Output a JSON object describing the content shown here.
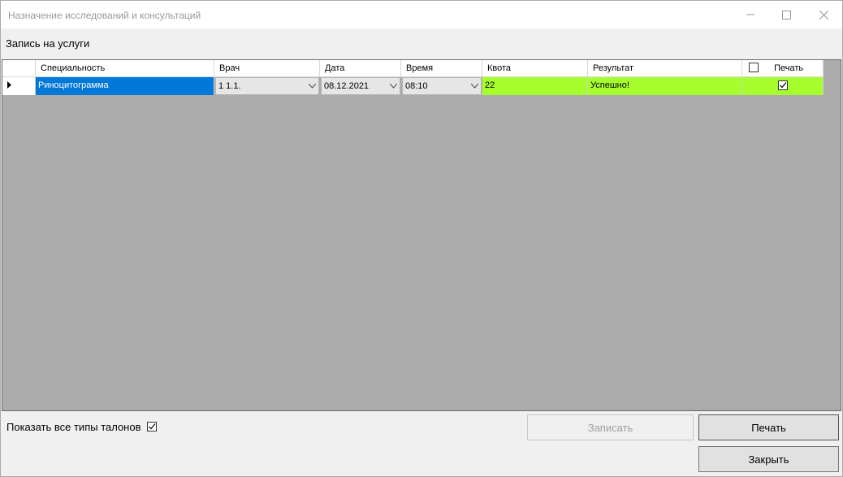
{
  "window": {
    "title": "Назначение исследований и консультаций"
  },
  "section": {
    "label": "Запись на услуги"
  },
  "grid": {
    "columns": {
      "specialty": "Специальность",
      "doctor": "Врач",
      "date": "Дата",
      "time": "Время",
      "quota": "Квота",
      "result": "Результат",
      "print": "Печать"
    },
    "rows": [
      {
        "specialty": "Риноцитограмма",
        "doctor": "1 1.1.",
        "date": "08.12.2021",
        "time": "08:10",
        "quota": "22",
        "result": "Успешно!",
        "print_checked": true
      }
    ],
    "colors": {
      "success": "#a6ff2d",
      "selected": "#0078d7",
      "background": "#ababab"
    }
  },
  "footer": {
    "show_all_label": "Показать все типы талонов",
    "show_all_checked": true,
    "save_label": "Записать",
    "print_label": "Печать",
    "close_label": "Закрыть"
  },
  "icons": [
    "minimize-icon",
    "maximize-icon",
    "close-icon",
    "row-pointer-icon",
    "chevron-down-icon",
    "checkbox-icon"
  ]
}
